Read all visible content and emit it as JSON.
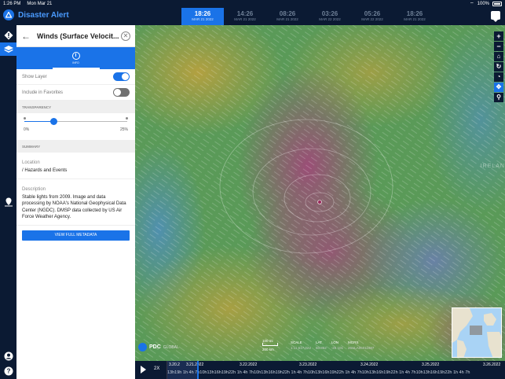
{
  "status_bar": {
    "time": "1:26 PM",
    "date": "Mon Mar 21",
    "battery": "100%"
  },
  "app": {
    "title": "Disaster Alert"
  },
  "clocks": [
    {
      "time": "18:26",
      "date": "MAR 21 2022",
      "active": true
    },
    {
      "time": "14:26",
      "date": "MAR 21 2022",
      "active": false
    },
    {
      "time": "08:26",
      "date": "MAR 21 2022",
      "active": false
    },
    {
      "time": "03:26",
      "date": "MAR 22 2022",
      "active": false
    },
    {
      "time": "05:26",
      "date": "MAR 22 2022",
      "active": false
    },
    {
      "time": "18:26",
      "date": "MAR 21 2022",
      "active": false
    }
  ],
  "rail": {
    "icons": [
      "alert-icon",
      "layers-icon",
      "pin-icon",
      "user-icon",
      "help-icon"
    ]
  },
  "panel": {
    "title": "Winds (Surface Velocit...",
    "tab_label": "INFO",
    "show_layer_label": "Show Layer",
    "show_layer_on": true,
    "favorites_label": "Include in Favorites",
    "favorites_on": false,
    "transparency_header": "TRANSPARENCY",
    "transparency_min": "0%",
    "transparency_max": "25%",
    "transparency_value": 0.28,
    "summary_header": "SUMMARY",
    "location_label": "Location",
    "location_value": "/ Hazards and Events",
    "description_label": "Description",
    "description_value": "Stable lights from 2009. Image and data processing by NOAA's National Geophysical Data Center (NGDC). DMSP data collected by US Air Force Weather Agency.",
    "metadata_button": "VIEW FULL METADATA"
  },
  "map": {
    "logo": "PDC",
    "logo_sub": "GLOBAL",
    "watermark": "IRELAN",
    "scale_top": "100 mi",
    "scale_bottom": "200 km",
    "readout": [
      {
        "label": "SCALE",
        "value": "1:11,617,022"
      },
      {
        "label": "LAT",
        "value": "50.852"
      },
      {
        "label": "LON",
        "value": "-29.101"
      },
      {
        "label": "MGRS",
        "value": "26ULA05011087"
      }
    ],
    "tools": [
      "zoom-in",
      "zoom-out",
      "home",
      "refresh",
      "history",
      "locate",
      "search"
    ]
  },
  "timeline": {
    "speed": "2X",
    "dates": [
      "3.20.2",
      "3.21.2022",
      "3.22.2022",
      "3.23.2022",
      "3.24.2022",
      "3.25.2022",
      "3.26.2022"
    ],
    "hours": "13h19h 1h 4h 7h10h13h16h19h22h 1h 4h 7h10h13h16h19h22h 1h 4h 7h10h13h16h19h22h 1h 4h 7h10h13h16h19h22h 1h 4h 7h10h13h16h19h22h 1h 4h 7h"
  }
}
